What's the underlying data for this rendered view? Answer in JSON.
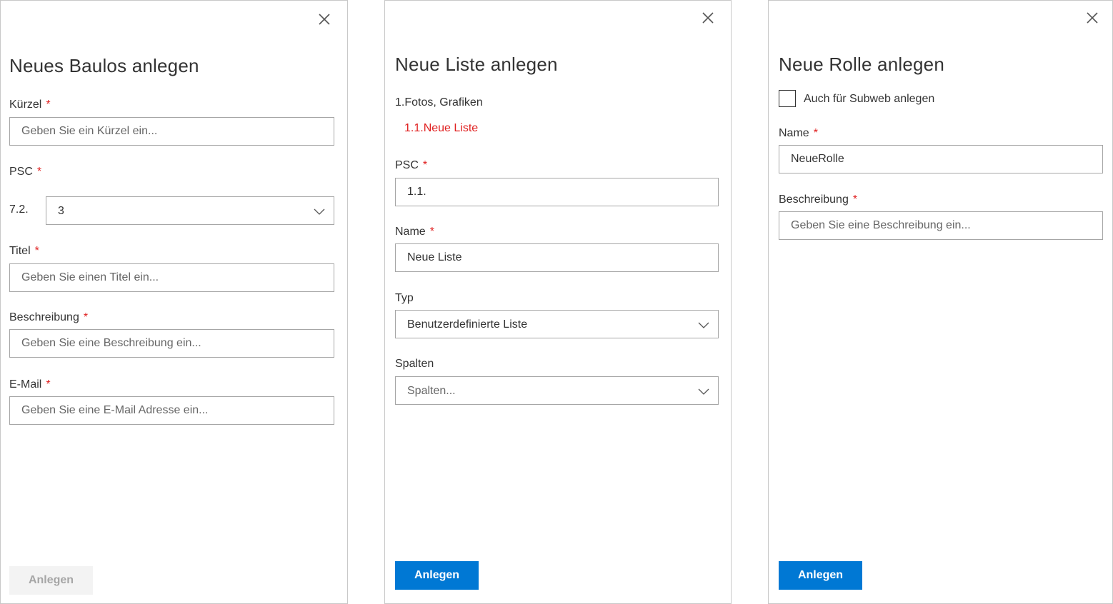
{
  "panel_baulos": {
    "title": "Neues Baulos anlegen",
    "kuerzel": {
      "label": "Kürzel",
      "required": "*",
      "placeholder": "Geben Sie ein Kürzel ein..."
    },
    "psc": {
      "label": "PSC",
      "required": "*",
      "prefix": "7.2.",
      "selected": "3"
    },
    "titel": {
      "label": "Titel",
      "required": "*",
      "placeholder": "Geben Sie einen Titel ein..."
    },
    "beschreibung": {
      "label": "Beschreibung",
      "required": "*",
      "placeholder": "Geben Sie eine Beschreibung ein..."
    },
    "email": {
      "label": "E-Mail",
      "required": "*",
      "placeholder": "Geben Sie eine E-Mail Adresse ein..."
    },
    "submit_label": "Anlegen"
  },
  "panel_liste": {
    "title": "Neue Liste anlegen",
    "parent_path": "1.Fotos, Grafiken",
    "new_item_path": "1.1.Neue Liste",
    "psc": {
      "label": "PSC",
      "required": "*",
      "value": "1.1."
    },
    "name": {
      "label": "Name",
      "required": "*",
      "value": "Neue Liste"
    },
    "typ": {
      "label": "Typ",
      "selected": "Benutzerdefinierte Liste"
    },
    "spalten": {
      "label": "Spalten",
      "placeholder": "Spalten..."
    },
    "submit_label": "Anlegen"
  },
  "panel_rolle": {
    "title": "Neue Rolle anlegen",
    "subweb_checkbox_label": "Auch für Subweb anlegen",
    "name": {
      "label": "Name",
      "required": "*",
      "value": "NeueRolle"
    },
    "beschreibung": {
      "label": "Beschreibung",
      "required": "*",
      "placeholder": "Geben Sie eine Beschreibung ein..."
    },
    "submit_label": "Anlegen"
  },
  "icons": {
    "close": "close-icon",
    "dropdown": "chevron-down-icon"
  },
  "colors": {
    "primary": "#0078d4",
    "required": "#e02020",
    "border": "#a6a6a6",
    "disabled_bg": "#f3f3f3",
    "disabled_text": "#a6a6a6"
  }
}
